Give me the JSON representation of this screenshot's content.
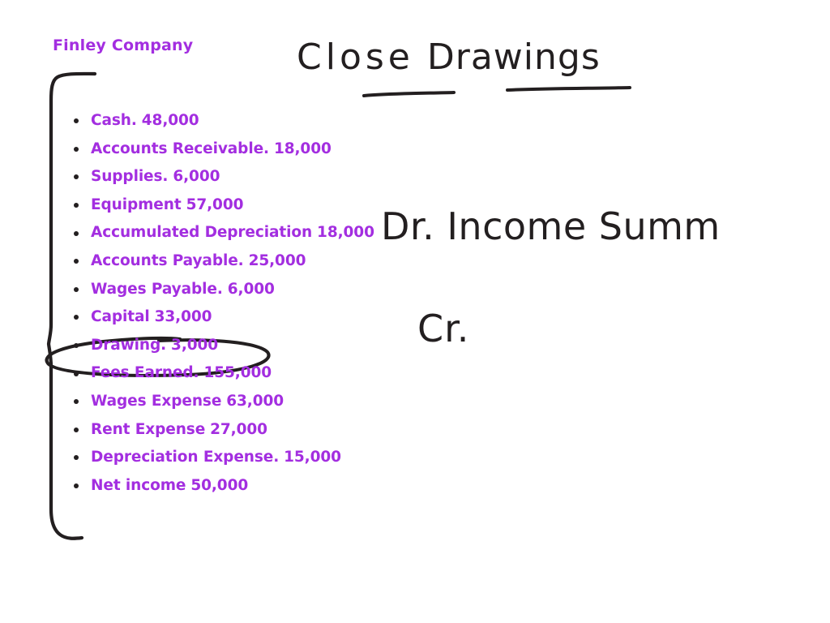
{
  "page": {
    "background_color": "#ffffff",
    "ink_color": "#231f20",
    "accent_color": "#a32ee0"
  },
  "company": {
    "title": "Finley Company"
  },
  "annotations": {
    "heading_word_1": "Close",
    "heading_word_2": "Drawings",
    "debit_line": "Dr. Income Summ",
    "credit_line": "Cr."
  },
  "trial_balance": {
    "rows": [
      {
        "label": "Cash.",
        "amount": "48,000",
        "highlighted": false
      },
      {
        "label": "Accounts Receivable.",
        "amount": "18,000",
        "highlighted": false
      },
      {
        "label": " Supplies.",
        "amount": "6,000",
        "highlighted": false
      },
      {
        "label": "Equipment",
        "amount": "57,000",
        "highlighted": false
      },
      {
        "label": "Accumulated Depreciation",
        "amount": "18,000",
        "highlighted": false
      },
      {
        "label": "Accounts Payable.",
        "amount": "25,000",
        "highlighted": false
      },
      {
        "label": "Wages Payable.",
        "amount": "6,000",
        "highlighted": false
      },
      {
        "label": "Capital",
        "amount": "33,000",
        "highlighted": false
      },
      {
        "label": "Drawing.",
        "amount": "3,000",
        "highlighted": true
      },
      {
        "label": "Fees Earned.",
        "amount": "155,000",
        "highlighted": false
      },
      {
        "label": "Wages Expense",
        "amount": "63,000",
        "highlighted": false
      },
      {
        "label": "Rent Expense",
        "amount": "27,000",
        "highlighted": false
      },
      {
        "label": "Depreciation Expense.",
        "amount": "15,000",
        "highlighted": false
      },
      {
        "label": "Net income",
        "amount": "50,000",
        "highlighted": false
      }
    ]
  }
}
